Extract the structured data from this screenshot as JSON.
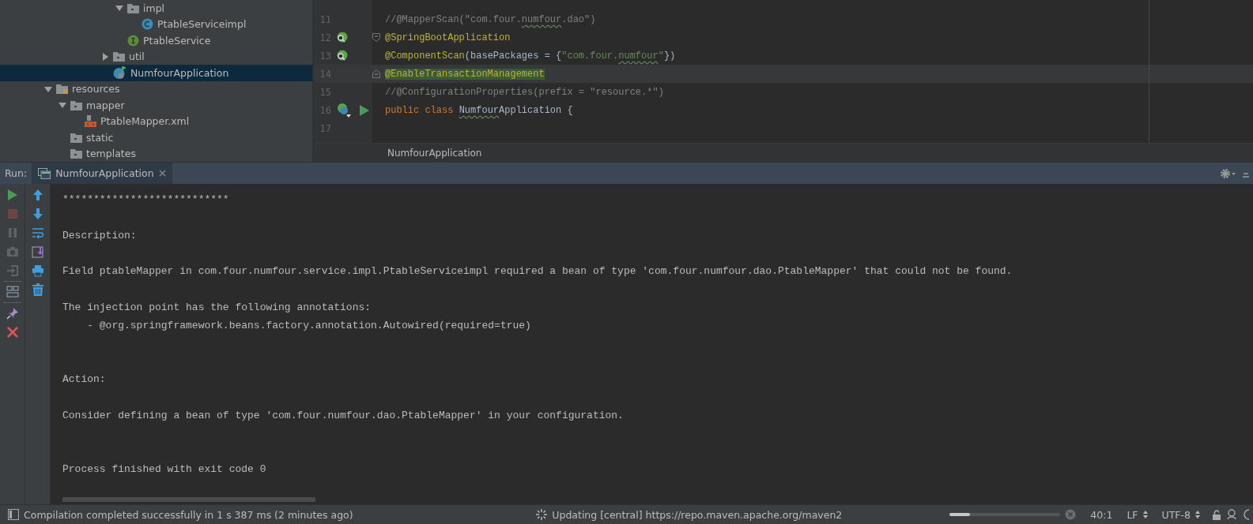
{
  "project_tree": [
    {
      "children": [
        {
          "children": [
            {
              "children": [
                {
                  "children": [
                    {
                      "children": [
                        {
                          "label": "impl",
                          "kind": "folder",
                          "expanded": true,
                          "selected": false,
                          "children": [
                            {
                              "label": "PtableServiceimpl",
                              "kind": "class",
                              "selected": false
                            }
                          ]
                        },
                        {
                          "label": "PtableService",
                          "kind": "interface",
                          "selected": false
                        }
                      ]
                    },
                    {
                      "label": "util",
                      "kind": "folder",
                      "expanded": false,
                      "selected": false
                    },
                    {
                      "label": "NumfourApplication",
                      "kind": "spring-class",
                      "selected": true
                    }
                  ]
                }
              ]
            }
          ]
        }
      ]
    },
    {
      "label": "resources",
      "kind": "resources-folder",
      "expanded": true,
      "selected": false,
      "children": [
        {
          "label": "mapper",
          "kind": "folder",
          "expanded": true,
          "selected": false,
          "children": [
            {
              "label": "PtableMapper.xml",
              "kind": "xml",
              "selected": false
            }
          ]
        },
        {
          "label": "static",
          "kind": "folder",
          "selected": false
        },
        {
          "label": "templates",
          "kind": "folder",
          "selected": false
        }
      ]
    }
  ],
  "editor": {
    "lines": [
      {
        "number": "11",
        "current": false,
        "tokens": [
          {
            "kind": "comment",
            "text": "//@MapperScan(\"com.four."
          },
          {
            "kind": "comment",
            "text": "numfour",
            "flagged": true
          },
          {
            "kind": "comment",
            "text": ".dao\")"
          }
        ]
      },
      {
        "number": "12",
        "current": false,
        "gutter": [
          {
            "kind": "bean"
          }
        ],
        "fold": {
          "kind": "open"
        },
        "tokens": [
          {
            "kind": "annotation",
            "text": "@SpringBootApplication"
          }
        ]
      },
      {
        "number": "13",
        "current": false,
        "gutter": [
          {
            "kind": "bean"
          }
        ],
        "tokens": [
          {
            "kind": "annotation",
            "text": "@ComponentScan"
          },
          {
            "kind": "plain",
            "text": "(basePackages = {"
          },
          {
            "kind": "string",
            "text": "\"com.four."
          },
          {
            "kind": "string",
            "text": "numfour",
            "flagged": true
          },
          {
            "kind": "string",
            "text": "\""
          },
          {
            "kind": "plain",
            "text": "})"
          }
        ]
      },
      {
        "number": "14",
        "current": true,
        "fold": {
          "kind": "close"
        },
        "tokens": [
          {
            "kind": "annotation",
            "text": "@EnableTransactionManagement",
            "marked": true
          }
        ]
      },
      {
        "number": "15",
        "current": false,
        "tokens": [
          {
            "kind": "comment",
            "text": "//@ConfigurationProperties(prefix = \"resource.*\")"
          }
        ]
      },
      {
        "number": "16",
        "current": false,
        "gutter": [
          {
            "kind": "spring-class"
          },
          {
            "kind": "run"
          }
        ],
        "tokens": [
          {
            "kind": "keyword",
            "text": "public class "
          },
          {
            "kind": "plain",
            "text": "Numfour",
            "flagged": true
          },
          {
            "kind": "plain",
            "text": "Application {"
          }
        ]
      },
      {
        "number": "17",
        "current": false
      }
    ],
    "breadcrumb": "NumfourApplication"
  },
  "run_panel": {
    "label": "Run:",
    "tabs": [
      {
        "label": "NumfourApplication",
        "selected": true
      }
    ],
    "toolbar_left": [
      {
        "kind": "run",
        "disabled": false
      },
      {
        "kind": "stop",
        "disabled": true
      },
      {
        "kind": "pause",
        "disabled": true
      },
      {
        "kind": "camera",
        "disabled": true
      },
      {
        "kind": "exit",
        "disabled": true
      },
      {
        "kind": "layout",
        "disabled": false
      },
      {
        "kind": "pin",
        "disabled": false
      },
      {
        "kind": "close",
        "disabled": false
      }
    ],
    "toolbar_right": [
      {
        "kind": "up",
        "disabled": false
      },
      {
        "kind": "down",
        "disabled": false
      },
      {
        "kind": "wrap",
        "disabled": false
      },
      {
        "kind": "scroll-end",
        "disabled": false
      },
      {
        "kind": "print",
        "disabled": false
      },
      {
        "kind": "trash",
        "disabled": false
      }
    ],
    "console": [
      {
        "kind": "text",
        "text": "***************************"
      },
      {
        "kind": "blank"
      },
      {
        "kind": "text",
        "text": "Description:"
      },
      {
        "kind": "blank"
      },
      {
        "kind": "text",
        "text": "Field ptableMapper in com.four.numfour.service.impl.PtableServiceimpl required a bean of type 'com.four.numfour.dao.PtableMapper' that could not be found."
      },
      {
        "kind": "blank"
      },
      {
        "kind": "text",
        "text": "The injection point has the following annotations:"
      },
      {
        "kind": "text",
        "text": "    - @org.springframework.beans.factory.annotation.Autowired(required=true)"
      },
      {
        "kind": "blank"
      },
      {
        "kind": "blank"
      },
      {
        "kind": "text",
        "text": "Action:"
      },
      {
        "kind": "blank"
      },
      {
        "kind": "text",
        "text": "Consider defining a bean of type 'com.four.numfour.dao.PtableMapper' in your configuration."
      },
      {
        "kind": "blank"
      },
      {
        "kind": "blank"
      },
      {
        "kind": "text",
        "text": "Process finished with exit code 0"
      }
    ]
  },
  "status_bar": {
    "message": "Compilation completed successfully in 1 s 387 ms (2 minutes ago)",
    "task": "Updating [central] https://repo.maven.apache.org/maven2",
    "progress": {
      "level": 0.18
    },
    "position": "40:1",
    "line_separator": "LF",
    "encoding": "UTF-8"
  }
}
